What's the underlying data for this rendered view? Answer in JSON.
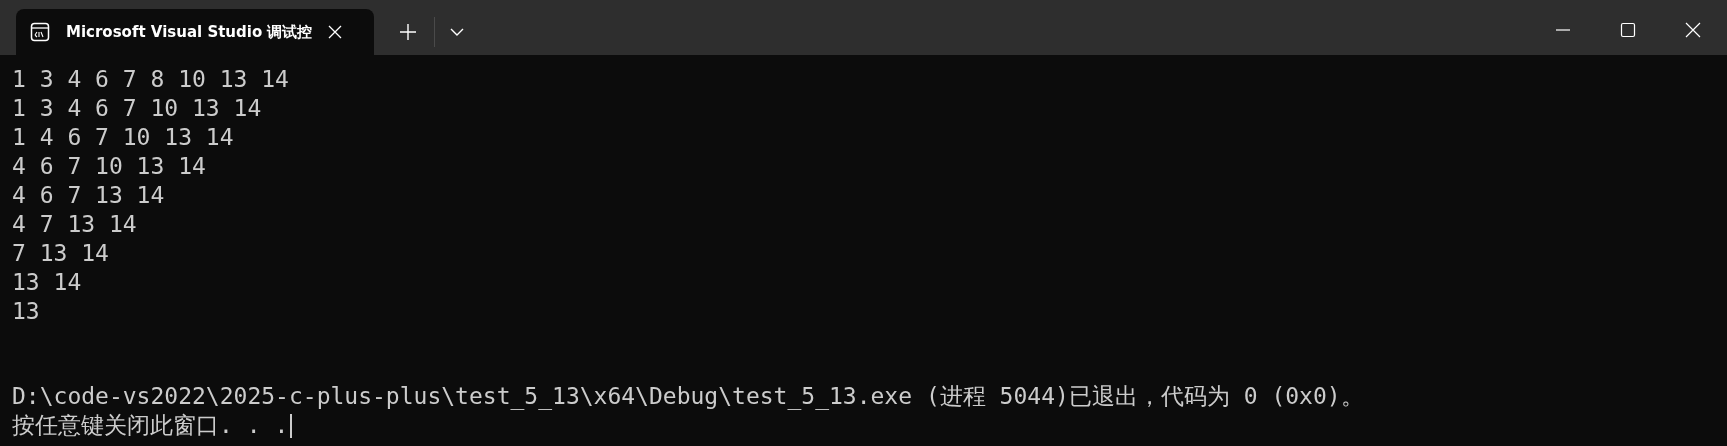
{
  "window": {
    "tab": {
      "title": "Microsoft Visual Studio 调试控",
      "selected": true
    }
  },
  "console": {
    "output": [
      "1 3 4 6 7 8 10 13 14",
      "1 3 4 6 7 10 13 14",
      "1 4 6 7 10 13 14",
      "4 6 7 10 13 14",
      "4 6 7 13 14",
      "4 7 13 14",
      "7 13 14",
      "13 14",
      "13"
    ],
    "status": [
      "D:\\code-vs2022\\2025-c-plus-plus\\test_5_13\\x64\\Debug\\test_5_13.exe (进程 5044)已退出，代码为 0 (0x0)。",
      "按任意键关闭此窗口. . ."
    ]
  }
}
